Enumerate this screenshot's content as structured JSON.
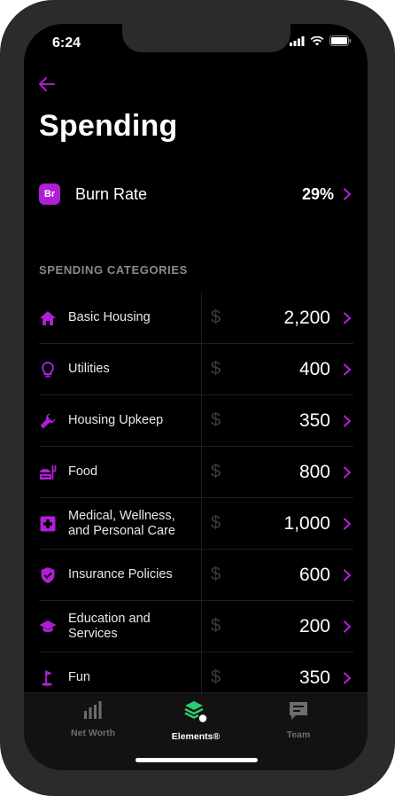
{
  "status_bar": {
    "time": "6:24"
  },
  "header": {
    "title": "Spending"
  },
  "burn_rate": {
    "badge": "Br",
    "label": "Burn Rate",
    "value": "29%"
  },
  "section": {
    "title": "SPENDING CATEGORIES"
  },
  "currency_symbol": "$",
  "categories": [
    {
      "icon": "home-icon",
      "label": "Basic Housing",
      "value": "2,200"
    },
    {
      "icon": "lightbulb-icon",
      "label": "Utilities",
      "value": "400"
    },
    {
      "icon": "wrench-icon",
      "label": "Housing Upkeep",
      "value": "350"
    },
    {
      "icon": "food-icon",
      "label": "Food",
      "value": "800"
    },
    {
      "icon": "medical-icon",
      "label": "Medical, Wellness,\nand Personal Care",
      "value": "1,000"
    },
    {
      "icon": "shield-check-icon",
      "label": "Insurance Policies",
      "value": "600"
    },
    {
      "icon": "graduation-cap-icon",
      "label": "Education and\nServices",
      "value": "200"
    },
    {
      "icon": "golf-flag-icon",
      "label": "Fun",
      "value": "350"
    }
  ],
  "tabs": [
    {
      "label": "Net Worth",
      "icon": "bar-chart-icon",
      "active": false
    },
    {
      "label": "Elements®",
      "icon": "layers-icon",
      "active": true
    },
    {
      "label": "Team",
      "icon": "chat-icon",
      "active": false
    }
  ],
  "colors": {
    "accent": "#b01ed6",
    "active_tab": "#2ecc71",
    "inactive_tab": "#6e6e6e",
    "background": "#000000"
  }
}
